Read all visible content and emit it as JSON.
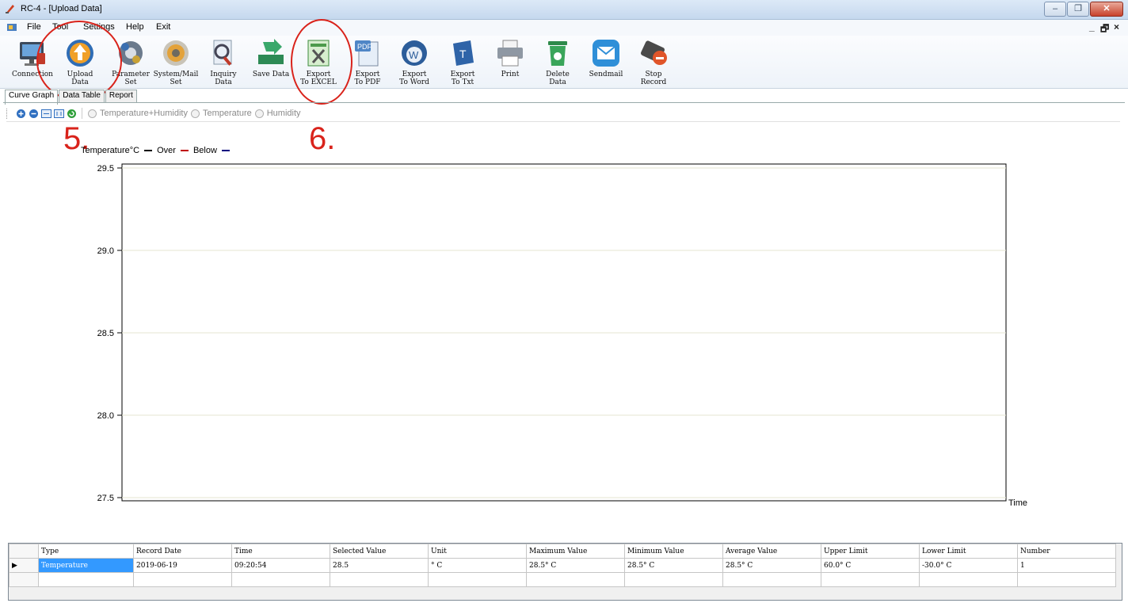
{
  "window": {
    "title": "RC-4 - [Upload Data]",
    "min": "–",
    "max": "❐",
    "close": "✕"
  },
  "menu": {
    "items": [
      "File",
      "Tool",
      "Settings",
      "Help",
      "Exit"
    ],
    "mdi_min": "_",
    "mdi_restore": "ß",
    "mdi_close": "×"
  },
  "toolbar": {
    "buttons": [
      {
        "label": "Connection",
        "icon": "monitor-connection-icon"
      },
      {
        "label": "Upload\nData",
        "icon": "upload-arrow-icon"
      },
      {
        "label": "Parameter\nSet",
        "icon": "gear-parameter-icon"
      },
      {
        "label": "System/Mail\nSet",
        "icon": "system-settings-icon"
      },
      {
        "label": "Inquiry\nData",
        "icon": "magnifier-inquiry-icon"
      },
      {
        "label": "Save Data",
        "icon": "save-arrow-icon"
      },
      {
        "label": "Export\nTo EXCEL",
        "icon": "excel-export-icon"
      },
      {
        "label": "Export\nTo PDF",
        "icon": "pdf-export-icon"
      },
      {
        "label": "Export\nTo Word",
        "icon": "word-export-icon"
      },
      {
        "label": "Export\nTo Txt",
        "icon": "txt-export-icon"
      },
      {
        "label": "Print",
        "icon": "printer-icon"
      },
      {
        "label": "Delete\nData",
        "icon": "trash-icon"
      },
      {
        "label": "Sendmail",
        "icon": "envelope-icon"
      },
      {
        "label": "Stop\nRecord",
        "icon": "stop-record-icon"
      }
    ]
  },
  "annotations": {
    "step5": "5.",
    "step6": "6.",
    "color": "#d9231b"
  },
  "tabs": [
    "Curve Graph",
    "Data Table",
    "Report"
  ],
  "graph_options": {
    "radios": [
      "Temperature+Humidity",
      "Temperature",
      "Humidity"
    ]
  },
  "chart_data": {
    "type": "line",
    "legend": [
      {
        "label": "Temperature°C",
        "color": "#000000"
      },
      {
        "label": "Over",
        "color": "#c00000"
      },
      {
        "label": "Below",
        "color": "#00007f"
      }
    ],
    "ylim": [
      27.5,
      29.5
    ],
    "yticks": [
      "29.5",
      "29.0",
      "28.5",
      "28.0",
      "27.5"
    ],
    "xlabel": "Time",
    "series": [],
    "grid": true
  },
  "datagrid": {
    "columns": [
      "Type",
      "Record Date",
      "Time",
      "Selected Value",
      "Unit",
      "Maximum Value",
      "Minimum Value",
      "Average Value",
      "Upper Limit",
      "Lower Limit",
      "Number"
    ],
    "rows": [
      [
        "Temperature",
        "2019-06-19",
        "09:20:54",
        "28.5",
        "° C",
        "28.5° C",
        "28.5° C",
        "28.5° C",
        "60.0° C",
        "-30.0° C",
        "1"
      ]
    ],
    "row_marker": "▶"
  }
}
